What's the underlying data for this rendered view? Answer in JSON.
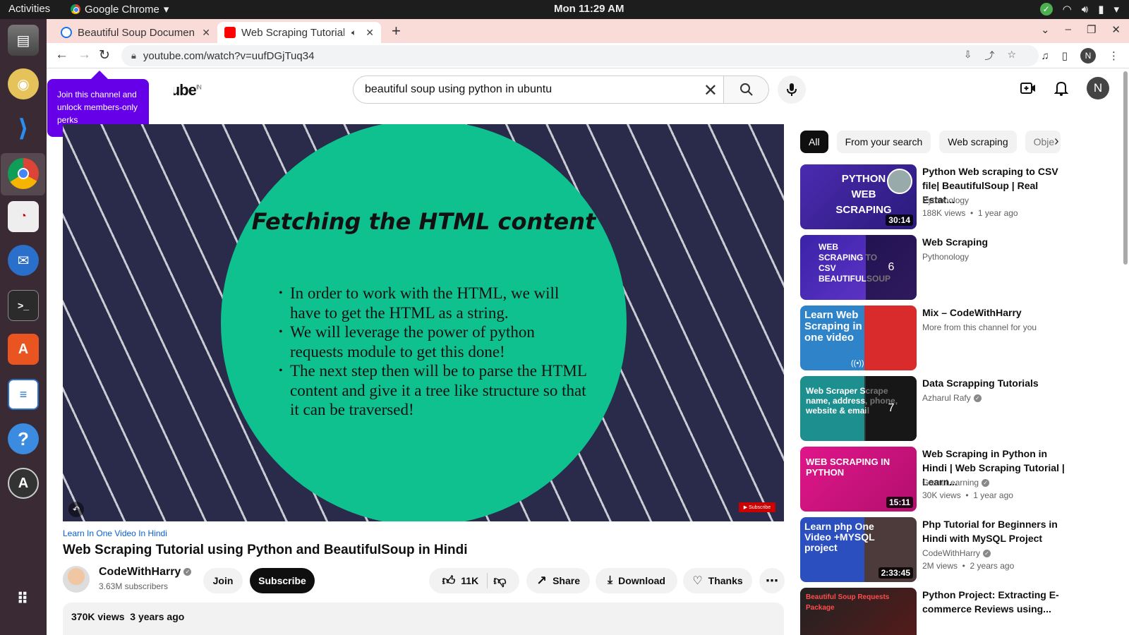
{
  "topbar": {
    "activities": "Activities",
    "app_name": "Google Chrome",
    "clock": "Mon 11:29 AM"
  },
  "tabs": [
    {
      "title": "Beautiful Soup Documen",
      "favicon_color": "#1a73e8"
    },
    {
      "title": "Web Scraping Tutorial",
      "favicon_color": "#ff0000"
    }
  ],
  "toolbar": {
    "url": "youtube.com/watch?v=uufDGjTuq34",
    "profile_initial": "N"
  },
  "youtube": {
    "logo_text": "YouTube",
    "country": "IN",
    "tooltip": "Join this channel and unlock members-only perks",
    "search_value": "beautiful soup using python in ubuntu",
    "avatar_initial": "N"
  },
  "video": {
    "slide_title": "Fetching the HTML content",
    "bullets": [
      "In order to work with the HTML, we will have to get the HTML as a string.",
      "We will leverage the power of python requests module to get this done!",
      "The next step then will be to parse the HTML content and give it a tree like structure so that it can be traversed!"
    ],
    "channel_tag": "Learn In One Video In Hindi",
    "title": "Web Scraping Tutorial using Python and BeautifulSoup in Hindi",
    "owner": "CodeWithHarry",
    "subscribers": "3.63M subscribers",
    "join": "Join",
    "subscribe": "Subscribe",
    "likes": "11K",
    "share": "Share",
    "download": "Download",
    "thanks": "Thanks",
    "stats": "370K views  3 years ago"
  },
  "chips": [
    "All",
    "From your search",
    "Web scraping",
    "Obje"
  ],
  "recommendations": [
    {
      "title": "Python Web scraping to CSV file| BeautifulSoup | Real Estat...",
      "channel": "Pythonology",
      "meta": "188K views  •  1 year ago",
      "duration": "30:14",
      "thumb_text": "PYTHON WEB SCRAPING",
      "thumb_color": "#4b2bb0",
      "verified": false
    },
    {
      "title": "Web Scraping",
      "channel": "Pythonology",
      "meta": "",
      "playlist_count": "6",
      "thumb_text": "WEB SCRAPING TO CSV BEAUTIFULSOUP",
      "thumb_color": "#3a22a8",
      "verified": false
    },
    {
      "title": "Mix – CodeWithHarry",
      "channel": "More from this channel for you",
      "meta": "",
      "thumb_text": "Learn Web Scraping in one video",
      "thumb_color": "#2f83c9",
      "verified": false
    },
    {
      "title": "Data Scrapping Tutorials",
      "channel": "Azharul Rafy",
      "meta": "",
      "playlist_count": "7",
      "thumb_text": "Web Scraper  Scrape name, address, phone, website & email",
      "thumb_color": "#1e8f8f",
      "verified": true
    },
    {
      "title": "Web Scraping in Python in Hindi | Web Scraping Tutorial | Learn...",
      "channel": "Great Learning",
      "meta": "30K views  •  1 year ago",
      "duration": "15:11",
      "thumb_text": "WEB SCRAPING IN PYTHON",
      "thumb_color": "#e0168a",
      "verified": true
    },
    {
      "title": "Php Tutorial for Beginners in Hindi with MySQL Project",
      "channel": "CodeWithHarry",
      "meta": "2M views  •  2 years ago",
      "duration": "2:33:45",
      "thumb_text": "Learn php One Video +MYSQL project",
      "thumb_color": "#2b4fbf",
      "verified": true
    },
    {
      "title": "Python Project: Extracting E-commerce Reviews using...",
      "channel": "",
      "meta": "",
      "thumb_text": "Beautiful Soup  Requests Package",
      "thumb_color": "#222222",
      "verified": false
    }
  ]
}
